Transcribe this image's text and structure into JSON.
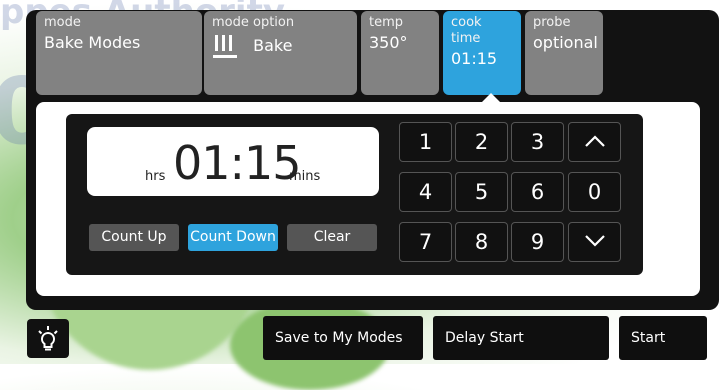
{
  "tabs": [
    {
      "small": "mode",
      "big": "Bake Modes"
    },
    {
      "small": "mode option",
      "big": "Bake",
      "icon": "bake-element-icon"
    },
    {
      "small": "temp",
      "big": "350°"
    },
    {
      "small": "cook time",
      "big": "01:15"
    },
    {
      "small": "probe",
      "big": "optional"
    }
  ],
  "display": {
    "hrs_label": "hrs",
    "time": "01:15",
    "mins_label": "mins"
  },
  "count_buttons": {
    "count_up": "Count Up",
    "count_down": "Count Down",
    "clear": "Clear"
  },
  "keypad": {
    "k1": "1",
    "k2": "2",
    "k3": "3",
    "k4": "4",
    "k5": "5",
    "k6": "6",
    "k7": "7",
    "k8": "8",
    "k9": "9",
    "k0": "0",
    "up_icon": "chevron-up-icon",
    "down_icon": "chevron-down-icon"
  },
  "bottom": {
    "light_icon": "oven-light-icon",
    "save": "Save to My Modes",
    "delay": "Delay Start",
    "start": "Start"
  },
  "colors": {
    "accent": "#2ea3dd",
    "panel": "#121212"
  }
}
